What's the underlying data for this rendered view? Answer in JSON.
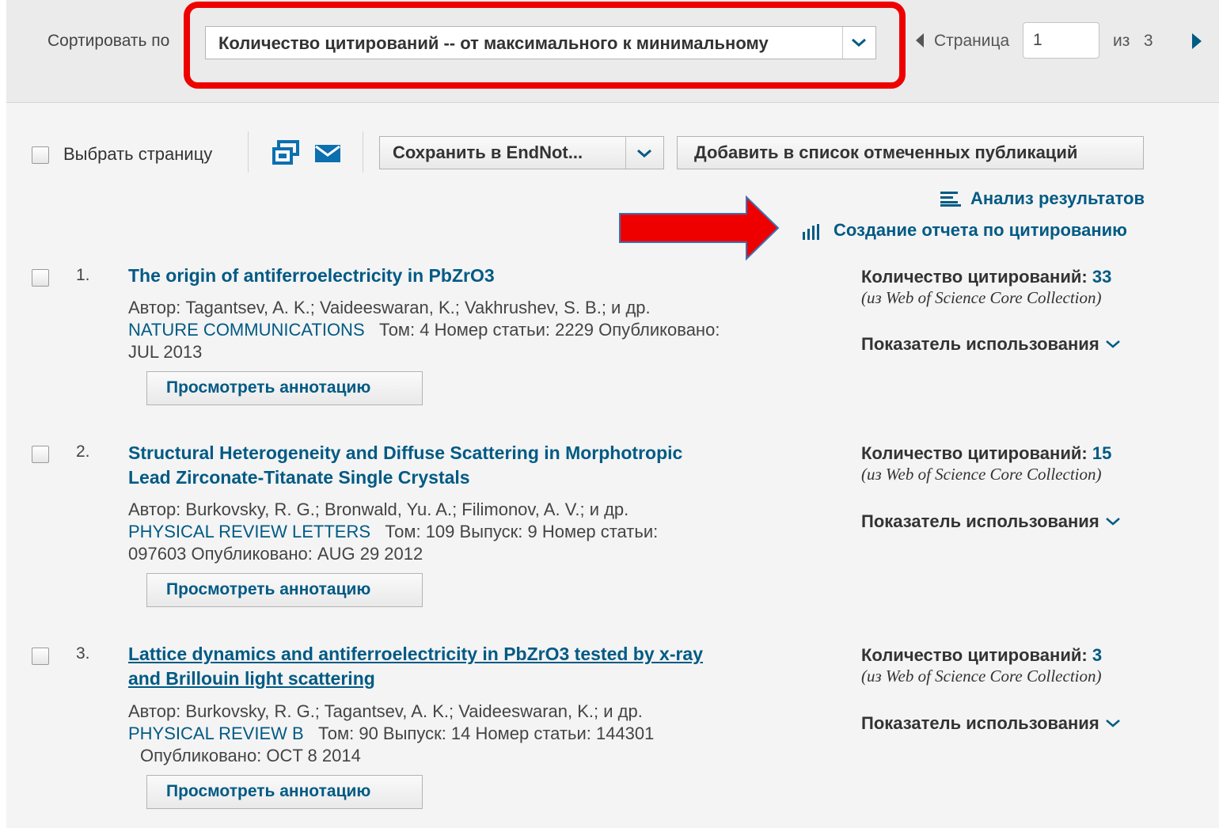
{
  "sort": {
    "label": "Сортировать по",
    "selected": "Количество цитирований -- от максимального к минимальному"
  },
  "pagination": {
    "page_label": "Страница",
    "page_value": "1",
    "of_label": "из",
    "total_pages": "3"
  },
  "toolbar": {
    "select_page_label": "Выбрать страницу",
    "save_label": "Сохранить в EndNot...",
    "add_marked_label": "Добавить в список отмеченных публикаций"
  },
  "links": {
    "analyze": "Анализ результатов",
    "citation_report": "Создание отчета по цитированию"
  },
  "annotations": {
    "highlight_color": "#ee0000",
    "arrow_color": "#ee0000"
  },
  "records": [
    {
      "num": "1.",
      "title_line1": "The origin of antiferroelectricity in PbZrO3",
      "title_line2": "",
      "authors": "Автор: Tagantsev, A. K.; Vaideeswaran, K.; Vakhrushev, S. B.; и др.",
      "journal": "NATURE COMMUNICATIONS",
      "details_line1": "Том: 4     Номер статьи: 2229    Опубликовано:",
      "details_line2": "JUL 2013",
      "abstract_label": "Просмотреть аннотацию",
      "times_cited_label": "Количество цитирований:",
      "times_cited": "33",
      "source": "(из Web of Science Core Collection)",
      "usage_label": "Показатель использования"
    },
    {
      "num": "2.",
      "title_line1": "Structural Heterogeneity and Diffuse Scattering in Morphotropic",
      "title_line2": "Lead Zirconate-Titanate Single Crystals",
      "authors": "Автор: Burkovsky, R. G.; Bronwald, Yu. A.; Filimonov, A. V.; и др.",
      "journal": "PHYSICAL REVIEW LETTERS",
      "details_line1": "Том: 109    Выпуск: 9      Номер статьи:",
      "details_line2": "097603    Опубликовано: AUG 29 2012",
      "abstract_label": "Просмотреть аннотацию",
      "times_cited_label": "Количество цитирований:",
      "times_cited": "15",
      "source": "(из Web of Science Core Collection)",
      "usage_label": "Показатель использования"
    },
    {
      "num": "3.",
      "title_line1": "Lattice dynamics and antiferroelectricity in PbZrO3 tested by x-ray",
      "title_line2": "and Brillouin light scattering",
      "authors": "Автор: Burkovsky, R. G.; Tagantsev, A. K.; Vaideeswaran, K.; и др.",
      "journal": "PHYSICAL REVIEW B",
      "details_line1": "Том: 90    Выпуск: 14      Номер статьи: 144301",
      "details_line2": "Опубликовано: OCT 8 2014",
      "abstract_label": "Просмотреть аннотацию",
      "times_cited_label": "Количество цитирований:",
      "times_cited": "3",
      "source": "(из Web of Science Core Collection)",
      "usage_label": "Показатель использования"
    }
  ]
}
